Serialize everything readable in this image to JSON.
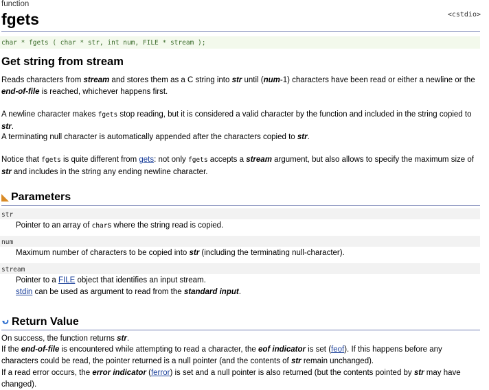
{
  "header": {
    "kind": "function",
    "title": "fgets",
    "library": "<cstdio>",
    "prototype": "char * fgets ( char * str, int num, FILE * stream );"
  },
  "summary": {
    "heading": "Get string from stream",
    "p1": {
      "a": "Reads characters from ",
      "b": "stream",
      "c": " and stores them as a C string into ",
      "d": "str",
      "e": " until (",
      "f": "num",
      "g": "-1) characters have been read or either a newline or the ",
      "h": "end-of-file",
      "i": " is reached, whichever happens first."
    },
    "p2": {
      "a": "A newline character makes ",
      "code": "fgets",
      "b": " stop reading, but it is considered a valid character by the function and included in the string copied to ",
      "c": "str",
      "d": "."
    },
    "p3": {
      "a": "A terminating null character is automatically appended after the characters copied to ",
      "b": "str",
      "c": "."
    },
    "p4": {
      "a": "Notice that ",
      "code1": "fgets",
      "b": " is quite different from ",
      "link": "gets",
      "c": ": not only ",
      "code2": "fgets",
      "d": " accepts a ",
      "e": "stream",
      "f": " argument, but also allows to specify the maximum size of ",
      "g": "str",
      "h": " and includes in the string any ending newline character."
    }
  },
  "parameters": {
    "heading": "Parameters",
    "str": {
      "name": "str",
      "a": "Pointer to an array of ",
      "code": "char",
      "b": "s where the string read is copied."
    },
    "num": {
      "name": "num",
      "a": "Maximum number of characters to be copied into ",
      "b": "str",
      "c": " (including the terminating null-character)."
    },
    "stream": {
      "name": "stream",
      "a": "Pointer to a ",
      "link": "FILE",
      "b": " object that identifies an input stream.",
      "link2": "stdin",
      "c": " can be used as argument to read from the ",
      "d": "standard input",
      "e": "."
    }
  },
  "return_value": {
    "heading": "Return Value",
    "l1": {
      "a": "On success, the function returns ",
      "b": "str",
      "c": "."
    },
    "l2": {
      "a": "If the ",
      "b": "end-of-file",
      "c": " is encountered while attempting to read a character, the ",
      "d": "eof indicator",
      "e": " is set (",
      "link": "feof",
      "f": "). If this happens before any characters could be read, the pointer returned is a null pointer (and the contents of ",
      "g": "str",
      "h": " remain unchanged)."
    },
    "l3": {
      "a": "If a read error occurs, the ",
      "b": "error indicator",
      "c": " (",
      "link": "ferror",
      "d": ") is set and a null pointer is also returned (but the contents pointed by ",
      "e": "str",
      "f": " may have changed)."
    }
  },
  "colors": {
    "rule": "#6d7ab0",
    "prototype_bg": "#f3f9ec",
    "prototype_text": "#3b6c2b",
    "param_bg": "#f2f2f2",
    "link": "#1a3f9a",
    "param_icon": "#d98a25",
    "return_icon": "#2e6fd0"
  },
  "icons": {
    "parameters": "triangle-icon",
    "return_value": "return-arrow-icon"
  }
}
